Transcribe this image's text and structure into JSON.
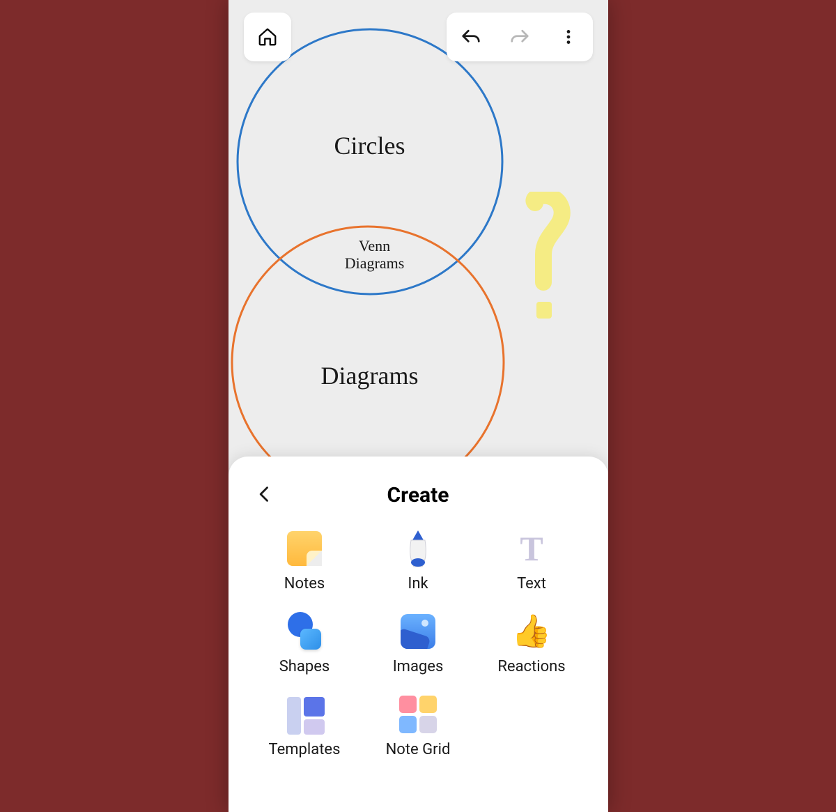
{
  "canvas": {
    "circle_top": {
      "label": "Circles",
      "color": "#2d78c8"
    },
    "circle_bottom": {
      "label": "Diagrams",
      "color": "#e8732d"
    },
    "intersection_label_line1": "Venn",
    "intersection_label_line2": "Diagrams",
    "highlighter_color": "#f5eb78"
  },
  "toolbar": {
    "home": "Home",
    "undo": "Undo",
    "redo": "Redo",
    "more": "More options",
    "redo_enabled": false
  },
  "sheet": {
    "title": "Create",
    "back": "Back",
    "items": [
      {
        "id": "notes",
        "label": "Notes"
      },
      {
        "id": "ink",
        "label": "Ink"
      },
      {
        "id": "text",
        "label": "Text"
      },
      {
        "id": "shapes",
        "label": "Shapes"
      },
      {
        "id": "images",
        "label": "Images"
      },
      {
        "id": "reactions",
        "label": "Reactions"
      },
      {
        "id": "templates",
        "label": "Templates"
      },
      {
        "id": "notegrid",
        "label": "Note Grid"
      }
    ]
  }
}
